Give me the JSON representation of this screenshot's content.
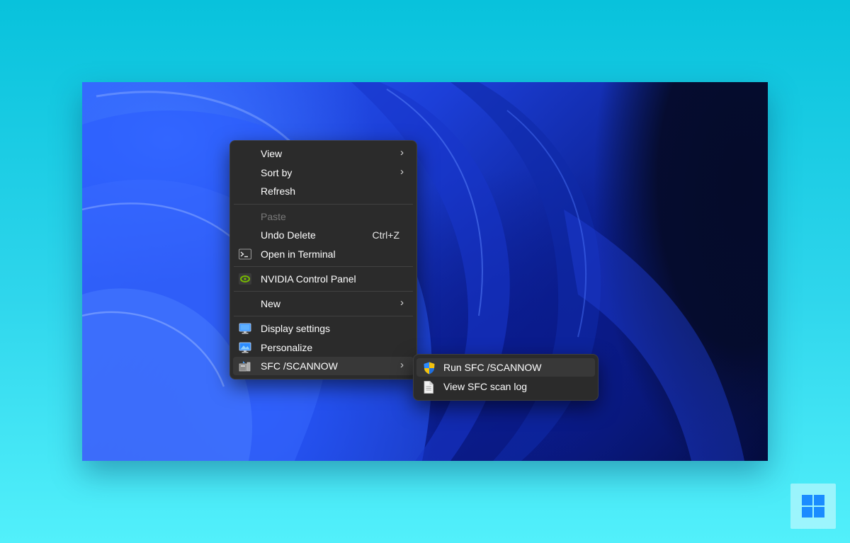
{
  "context_menu": {
    "items": [
      {
        "label": "View",
        "has_submenu": true
      },
      {
        "label": "Sort by",
        "has_submenu": true
      },
      {
        "label": "Refresh"
      },
      {
        "label": "Paste",
        "disabled": true
      },
      {
        "label": "Undo Delete",
        "shortcut": "Ctrl+Z"
      },
      {
        "label": "Open in Terminal",
        "icon": "terminal-icon"
      },
      {
        "label": "NVIDIA Control Panel",
        "icon": "nvidia-icon"
      },
      {
        "label": "New",
        "has_submenu": true
      },
      {
        "label": "Display settings",
        "icon": "display-icon"
      },
      {
        "label": "Personalize",
        "icon": "personalize-icon"
      },
      {
        "label": "SFC /SCANNOW",
        "icon": "sfc-tool-icon",
        "has_submenu": true,
        "highlighted": true
      }
    ],
    "chevron": "›"
  },
  "submenu": {
    "items": [
      {
        "label": "Run SFC /SCANNOW",
        "icon": "uac-shield-icon",
        "highlighted": true
      },
      {
        "label": "View SFC scan log",
        "icon": "document-icon"
      }
    ]
  },
  "colors": {
    "menu_bg": "#2b2b2b",
    "highlight": "#383838",
    "page_bg_top": "#08c2dc",
    "page_bg_bottom": "#52f0fb",
    "windows_blue": "#1a8cff"
  },
  "badge": {
    "icon": "windows-logo-icon"
  }
}
